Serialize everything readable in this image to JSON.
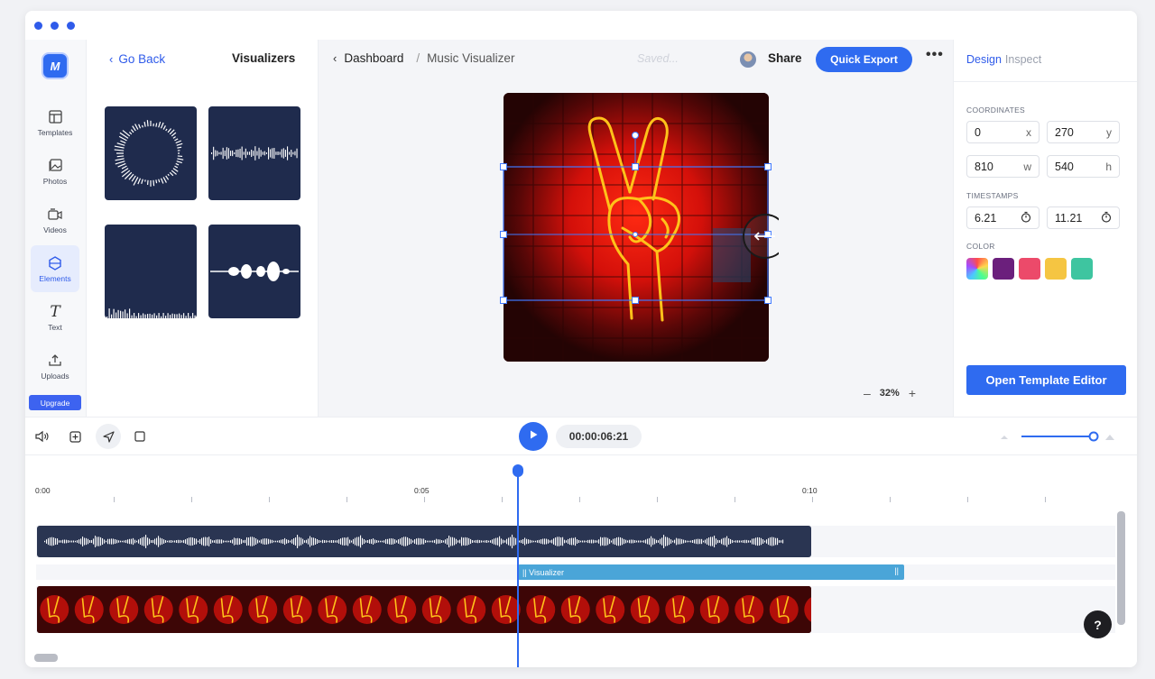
{
  "rail": {
    "items": [
      {
        "label": "Templates",
        "icon": "templates-icon"
      },
      {
        "label": "Photos",
        "icon": "photos-icon"
      },
      {
        "label": "Videos",
        "icon": "videos-icon"
      },
      {
        "label": "Elements",
        "icon": "elements-icon"
      },
      {
        "label": "Text",
        "icon": "text-icon"
      },
      {
        "label": "Uploads",
        "icon": "uploads-icon"
      }
    ],
    "upgrade_label": "Upgrade"
  },
  "panel": {
    "back_label": "Go Back",
    "title": "Visualizers",
    "thumbnails": [
      "circular-wave",
      "line-bars",
      "bottom-bars",
      "blob-wave"
    ]
  },
  "topbar": {
    "breadcrumb_root": "Dashboard",
    "breadcrumb_sep": "/",
    "breadcrumb_current": "Music Visualizer",
    "saved_status": "Saved...",
    "share_label": "Share",
    "export_label": "Quick Export",
    "more_label": "•••"
  },
  "canvas": {
    "zoom": "32%",
    "zoom_out": "–",
    "zoom_in": "+"
  },
  "inspector": {
    "tab_design": "Design",
    "tab_inspect": "Inspect",
    "coordinates_label": "COORDINATES",
    "x_value": "0",
    "x_suffix": "x",
    "y_value": "270",
    "y_suffix": "y",
    "w_value": "810",
    "w_suffix": "w",
    "h_value": "540",
    "h_suffix": "h",
    "timestamps_label": "TIMESTAMPS",
    "start_time": "6.21",
    "end_time": "11.21",
    "color_label": "COLOR",
    "colors": [
      "#6b1f7c",
      "#ec4a6a",
      "#f5c542",
      "#3ec5a0"
    ],
    "open_editor_label": "Open Template Editor"
  },
  "timeline": {
    "timecode": "00:00:06:21",
    "ruler_labels": [
      "0:00",
      "0:05",
      "0:10"
    ],
    "viz_clip_label": "|| Visualizer",
    "viz_clip_end": "||",
    "help_label": "?"
  }
}
